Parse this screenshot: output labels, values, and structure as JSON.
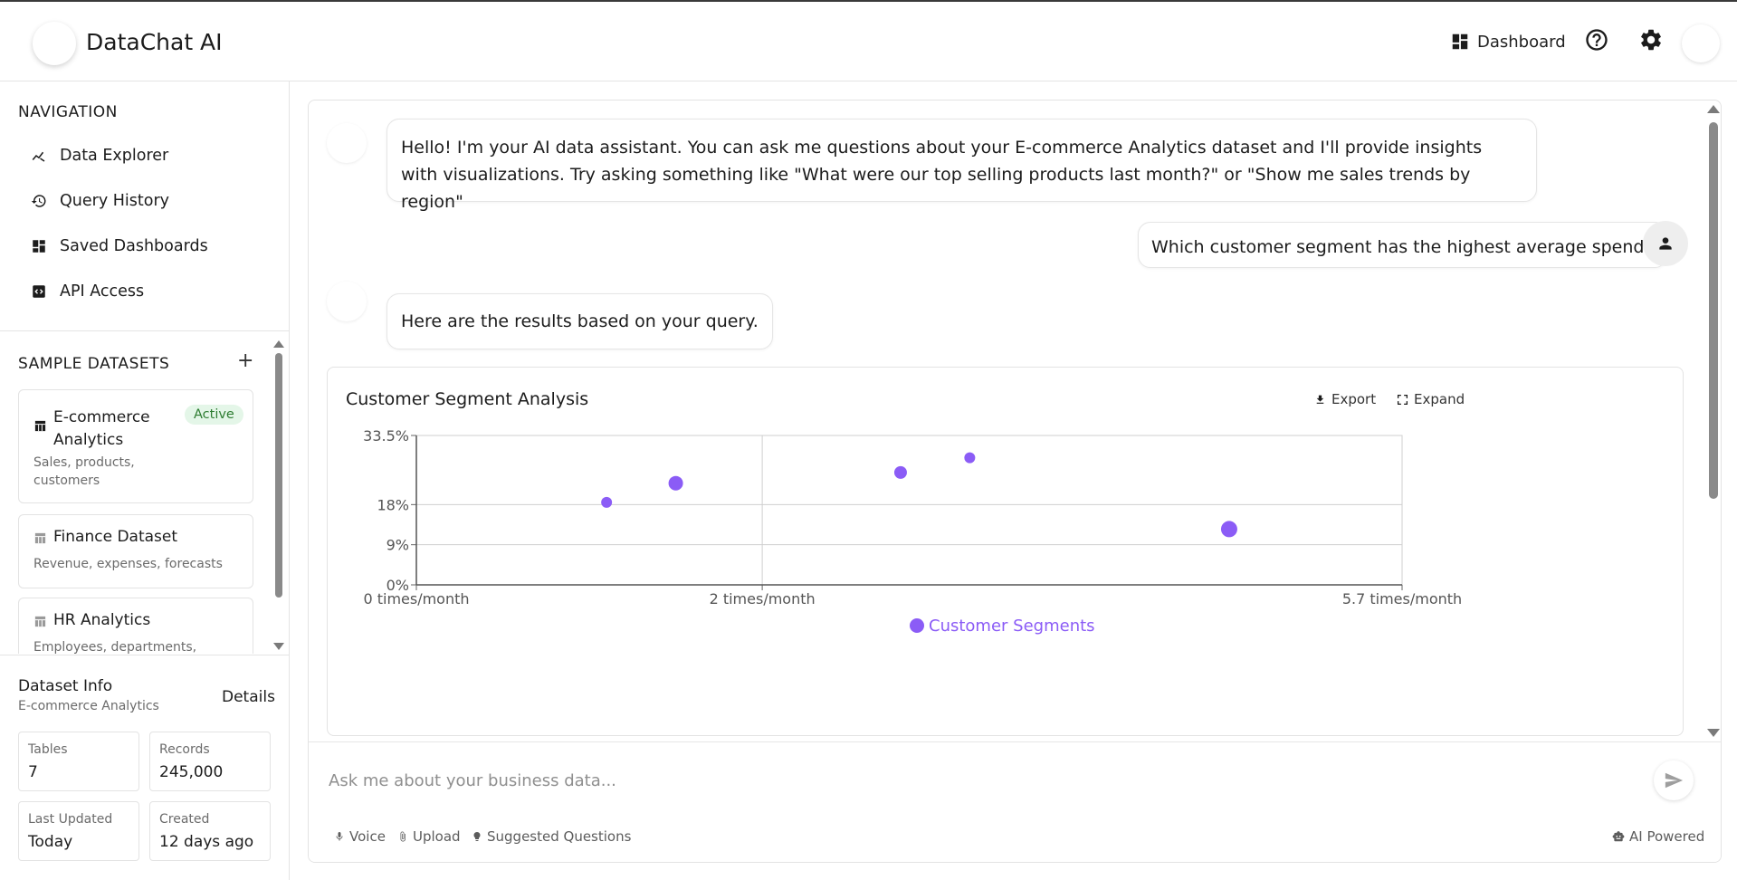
{
  "header": {
    "app_title": "DataChat AI",
    "dashboard_label": "Dashboard"
  },
  "sidebar": {
    "nav_title": "NAVIGATION",
    "nav_items": [
      {
        "label": "Data Explorer",
        "icon": "chart-line-icon"
      },
      {
        "label": "Query History",
        "icon": "history-icon"
      },
      {
        "label": "Saved Dashboards",
        "icon": "dashboard-icon"
      },
      {
        "label": "API Access",
        "icon": "api-icon"
      }
    ],
    "datasets_title": "SAMPLE DATASETS",
    "datasets": [
      {
        "name": "E-commerce Analytics",
        "desc": "Sales, products, customers",
        "badge": "Active"
      },
      {
        "name": "Finance Dataset",
        "desc": "Revenue, expenses, forecasts"
      },
      {
        "name": "HR Analytics",
        "desc": "Employees, departments,"
      }
    ],
    "info": {
      "title": "Dataset Info",
      "subtitle": "E-commerce Analytics",
      "details_label": "Details",
      "stats": [
        {
          "label": "Tables",
          "value": "7"
        },
        {
          "label": "Records",
          "value": "245,000"
        },
        {
          "label": "Last Updated",
          "value": "Today"
        },
        {
          "label": "Created",
          "value": "12 days ago"
        }
      ]
    }
  },
  "chat": {
    "messages": [
      {
        "role": "assistant",
        "text": "Hello! I'm your AI data assistant. You can ask me questions about your E-commerce Analytics dataset and I'll provide insights with visualizations. Try asking something like \"What were our top selling products last month?\" or \"Show me sales trends by region\""
      },
      {
        "role": "user",
        "text": "Which customer segment has the highest average spend?"
      },
      {
        "role": "assistant",
        "text": "Here are the results based on your query."
      }
    ]
  },
  "chart_card": {
    "title": "Customer Segment Analysis",
    "export_label": "Export",
    "expand_label": "Expand"
  },
  "chart_data": {
    "type": "scatter",
    "title": "Customer Segment Analysis",
    "xlabel": "",
    "ylabel": "",
    "x_ticks": [
      "0 times/month",
      "2 times/month",
      "5.7 times/month"
    ],
    "x_tick_values": [
      0,
      2,
      5.7
    ],
    "y_ticks": [
      "0%",
      "9%",
      "18%",
      "33.5%"
    ],
    "y_tick_values": [
      0,
      9,
      18,
      33.5
    ],
    "xlim": [
      0,
      5.7
    ],
    "ylim": [
      0,
      33.5
    ],
    "grid": true,
    "legend_position": "bottom",
    "color": "#8b5cf6",
    "series": [
      {
        "name": "Customer Segments",
        "points": [
          {
            "x": 1.1,
            "y": 18.5,
            "size": 6
          },
          {
            "x": 1.5,
            "y": 22.8,
            "size": 8
          },
          {
            "x": 2.8,
            "y": 25.2,
            "size": 7
          },
          {
            "x": 3.2,
            "y": 28.5,
            "size": 6
          },
          {
            "x": 4.7,
            "y": 12.5,
            "size": 9
          }
        ]
      }
    ]
  },
  "composer": {
    "placeholder": "Ask me about your business data...",
    "tools": [
      "Voice",
      "Upload",
      "Suggested Questions"
    ],
    "ai_label": "AI Powered"
  }
}
